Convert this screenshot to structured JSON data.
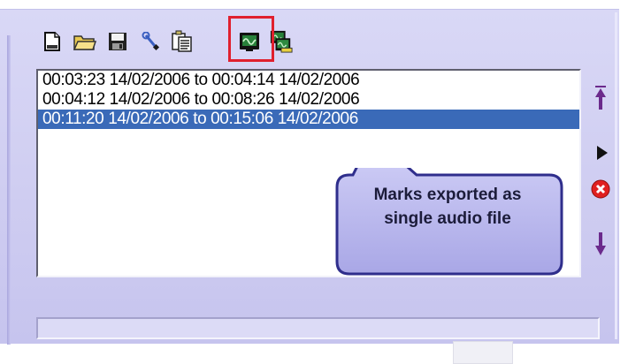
{
  "toolbar": {
    "buttons": [
      {
        "icon": "new-document-icon"
      },
      {
        "icon": "open-folder-icon"
      },
      {
        "icon": "save-disk-icon"
      },
      {
        "icon": "wrench-icon"
      },
      {
        "icon": "copy-clipboard-icon"
      },
      {
        "icon": "export-audio-waveform-icon",
        "highlighted": true
      },
      {
        "icon": "export-separate-files-icon"
      }
    ],
    "highlight_color": "#e0202e"
  },
  "marks_list": {
    "items": [
      {
        "label": "00:03:23 14/02/2006 to 00:04:14 14/02/2006",
        "selected": false
      },
      {
        "label": "00:04:12 14/02/2006 to 00:08:26 14/02/2006",
        "selected": false
      },
      {
        "label": "00:11:20 14/02/2006 to 00:15:06 14/02/2006",
        "selected": true
      }
    ],
    "selection_color": "#3a6ab8"
  },
  "side_buttons": [
    {
      "icon": "move-to-top-arrow-icon"
    },
    {
      "icon": "play-icon"
    },
    {
      "icon": "delete-red-x-icon"
    },
    {
      "icon": "move-down-arrow-icon"
    }
  ],
  "callout": {
    "text": "Marks exported as single audio file",
    "fill_color": "#b9b8ee",
    "border_color": "#2f2e8c"
  },
  "colors": {
    "panel_background": "#d2d0f3",
    "list_background": "#ffffff"
  }
}
